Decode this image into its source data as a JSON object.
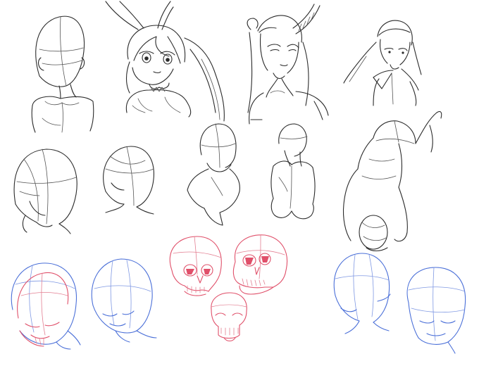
{
  "ink_colors": {
    "graphite": "#2b2b2b",
    "construction_red": "#e0506a",
    "construction_blue": "#4a6fd8",
    "paper": "#ffffff"
  },
  "sketches": [
    {
      "name": "bald-mannequin-bust",
      "ink": "graphite"
    },
    {
      "name": "bunny-ear-girl-portrait",
      "ink": "graphite"
    },
    {
      "name": "horned-girl-portrait",
      "ink": "graphite"
    },
    {
      "name": "girl-with-headband-portrait",
      "ink": "graphite"
    },
    {
      "name": "head-construction-three-quarter",
      "ink": "graphite"
    },
    {
      "name": "head-construction-back-view",
      "ink": "graphite"
    },
    {
      "name": "head-and-shoulders-from-behind",
      "ink": "graphite"
    },
    {
      "name": "torso-from-behind",
      "ink": "graphite"
    },
    {
      "name": "foreshortened-figure-from-above",
      "ink": "graphite"
    },
    {
      "name": "head-construction-looking-down",
      "ink": "red-and-blue"
    },
    {
      "name": "head-construction-downward-tilt",
      "ink": "blue"
    },
    {
      "name": "skull-three-quarter-left",
      "ink": "red"
    },
    {
      "name": "skull-three-quarter-right",
      "ink": "red"
    },
    {
      "name": "skull-from-below",
      "ink": "red"
    },
    {
      "name": "head-construction-upward-tilt",
      "ink": "blue"
    },
    {
      "name": "head-construction-front-view",
      "ink": "blue"
    }
  ]
}
